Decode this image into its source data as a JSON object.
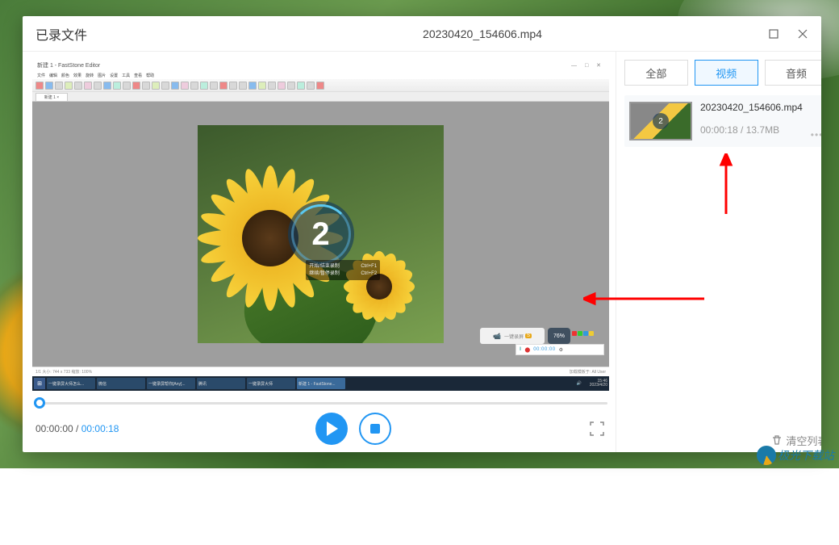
{
  "window": {
    "title": "已录文件",
    "filename": "20230420_154606.mp4"
  },
  "editor": {
    "title": "新建 1 - FastStone Editor",
    "win_controls": "—  □  ✕",
    "menu_items": [
      "文件",
      "编辑",
      "颜色",
      "效果",
      "旋转",
      "图片",
      "设置",
      "工具",
      "查看",
      "帮助"
    ],
    "tab_label": "新建 1 ×",
    "countdown": "2",
    "hint_line1_left": "开始/结束录制",
    "hint_line1_right": "Ctrl+F1",
    "hint_line2_left": "继续/暂停录制",
    "hint_line2_right": "Ctrl+F2",
    "float_tools_label": "一键录屏",
    "float_badge": "76%",
    "status_left": "1/1   大小: 744 x 733   缩放: 100%",
    "status_right": "加载模板于: All User",
    "rec_time": "00:00:00"
  },
  "taskbar": {
    "items": [
      "一键录屏大师怎么...",
      "微信",
      "一键录屏帮你[Any]...",
      "腾讯",
      "一键录屏大师",
      "新建 1 - FastStone..."
    ],
    "time": "15:46",
    "date": "2023/4/20"
  },
  "player": {
    "current_time": "00:00:00",
    "total_time": "00:00:18"
  },
  "tabs": {
    "all": "全部",
    "video": "视频",
    "audio": "音频"
  },
  "file_item": {
    "name": "20230420_154606.mp4",
    "meta": "00:00:18 / 13.7MB",
    "thumb_badge": "2"
  },
  "footer": {
    "clear_list": "清空列表"
  },
  "watermark": "极光下载站"
}
